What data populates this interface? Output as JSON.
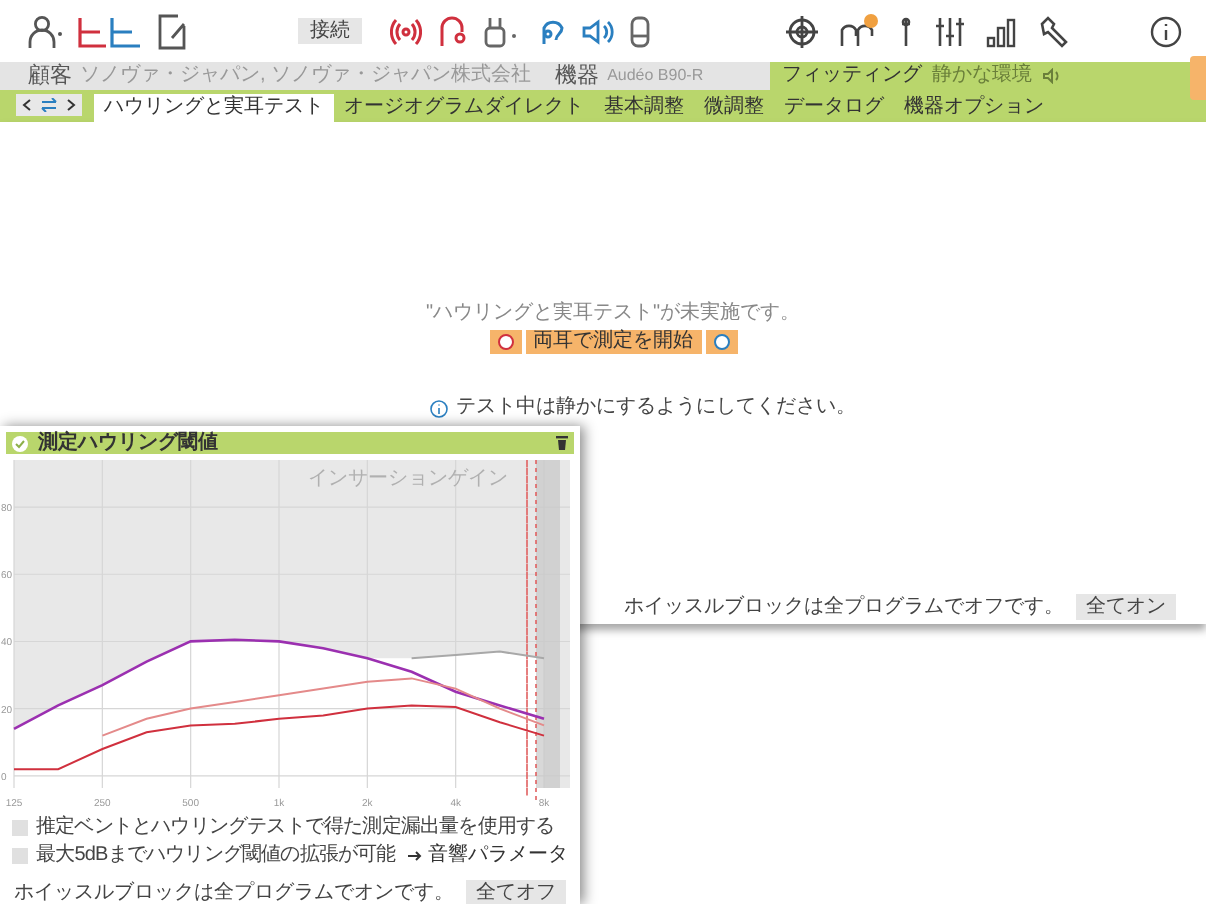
{
  "toolbar": {
    "connect_button": "接続"
  },
  "info_bar": {
    "client_label": "顧客",
    "client": "ソノヴァ・ジャパン, ソノヴァ・ジャパン株式会社",
    "device_label": "機器",
    "device": "Audéo B90-R",
    "fitting_label": "フィッティング",
    "environment": "静かな環境"
  },
  "tabs": [
    {
      "label": "ハウリングと実耳テスト",
      "selected": true
    },
    {
      "label": "オージオグラムダイレクト",
      "selected": false
    },
    {
      "label": "基本調整",
      "selected": false
    },
    {
      "label": "微調整",
      "selected": false
    },
    {
      "label": "データログ",
      "selected": false
    },
    {
      "label": "機器オプション",
      "selected": false
    }
  ],
  "main": {
    "status_message": "\"ハウリングと実耳テスト\"が未実施です。",
    "start_button": "両耳で測定を開始",
    "hint": "テスト中は静かにするようにしてください。",
    "whistle_text": "ホイッスルブロックは全プログラムでオフです。",
    "whistle_button": "全てオン"
  },
  "panel": {
    "title": "測定ハウリング閾値",
    "chart_label": "インサーションゲイン",
    "chart_data": {
      "type": "line",
      "categories": [
        "125",
        null,
        "250",
        null,
        "500",
        null,
        "1k",
        null,
        "2k",
        null,
        "4k",
        null,
        "8k"
      ],
      "series": [
        {
          "color": "#9b30b0",
          "values": [
            14,
            21,
            27,
            34,
            40,
            40.5,
            40,
            38,
            35,
            31,
            25,
            21,
            17
          ]
        },
        {
          "color": "#e48a8a",
          "values": [
            null,
            null,
            12,
            17,
            20,
            22,
            24,
            26,
            28,
            29,
            26,
            20,
            15
          ]
        },
        {
          "color": "#d0303e",
          "values": [
            2,
            2,
            8,
            13,
            15,
            15.5,
            17,
            18,
            20,
            21,
            20.5,
            16,
            12
          ]
        },
        {
          "color": "#a8a8a8",
          "values": [
            null,
            null,
            null,
            null,
            null,
            null,
            null,
            null,
            null,
            35,
            36,
            37,
            35
          ]
        }
      ],
      "ylim": [
        -3.6,
        94
      ],
      "yticks": [
        0,
        20,
        40,
        60,
        80
      ],
      "grid": true
    },
    "options": [
      {
        "label": "推定ベントとハウリングテストで得た測定漏出量を使用する",
        "checked": false
      },
      {
        "label": "最大5dBまでハウリング閾値の拡張が可能",
        "checked": false
      }
    ],
    "link": "音響パラメータ",
    "whistle_text": "ホイッスルブロックは全プログラムでオンです。",
    "whistle_button": "全てオフ"
  }
}
